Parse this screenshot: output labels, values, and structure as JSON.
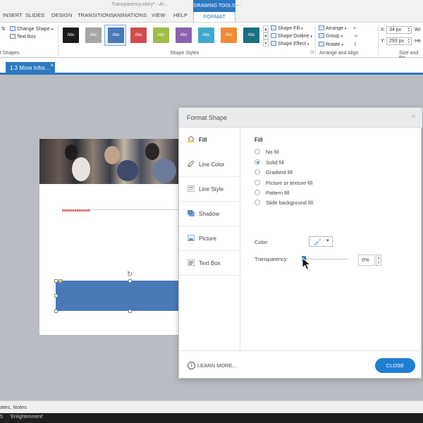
{
  "window": {
    "title": "Transparency.story* - Ar...",
    "contextual_tab": "DRAWING TOOLS"
  },
  "ribbon_tabs": {
    "insert": "INSERT",
    "slides": "SLIDES",
    "design": "DESIGN",
    "transitions": "TRANSITIONS",
    "animations": "ANIMATIONS",
    "view": "VIEW",
    "help": "HELP",
    "format": "FORMAT"
  },
  "ribbon": {
    "insert_shapes": {
      "change_shape": "Change Shape",
      "text_box": "Text Box",
      "label": "t Shapes"
    },
    "shape_styles": {
      "label": "Shape Styles",
      "swatches": [
        {
          "text": "Abc",
          "color": "#1b1b1b"
        },
        {
          "text": "Abc",
          "color": "#a5a5a5"
        },
        {
          "text": "Abc",
          "color": "#4a79b8"
        },
        {
          "text": "Abc",
          "color": "#d04c4c"
        },
        {
          "text": "Abc",
          "color": "#9fbc49"
        },
        {
          "text": "Abc",
          "color": "#8a62ad"
        },
        {
          "text": "Abc",
          "color": "#3fa8cf"
        },
        {
          "text": "Abc",
          "color": "#f08a35"
        },
        {
          "text": "Abc",
          "color": "#176e80"
        }
      ],
      "shape_fill": "Shape Fill",
      "shape_outline": "Shape Outline",
      "shape_effect": "Shape Effect"
    },
    "arrange": {
      "label": "Arrange and Align",
      "arrange": "Arrange",
      "group": "Group",
      "rotate": "Rotate"
    },
    "size": {
      "label": "Size and Po",
      "x_label": "X:",
      "x_value": "34 px",
      "y_label": "Y:",
      "y_value": "293 px",
      "w_label": "Wi",
      "h_label": "He"
    }
  },
  "document_tab": {
    "label": "1.3 More Infor...",
    "close": "×"
  },
  "format_shape": {
    "title": "Format Shape",
    "close": "×",
    "nav": [
      "Fill",
      "Line Color",
      "Line Style",
      "Shadow",
      "Picture",
      "Text Box"
    ],
    "section_title": "Fill",
    "fill_options": [
      "No fill",
      "Solid fill",
      "Gradient fill",
      "Picture or texture fill",
      "Pattern fill",
      "Slide background fill"
    ],
    "selected_fill": "Solid fill",
    "color_label": "Color:",
    "transparency_label": "Transparency:",
    "transparency_value": "0%",
    "transparency_level": 0,
    "learn_more": "LEARN MORE...",
    "close_button": "CLOSE",
    "accent": "#1f7fd1"
  },
  "status": {
    "text": "ates, Notes",
    "taskbar_num": "5",
    "taskbar_text": "'Enlightenment'"
  }
}
